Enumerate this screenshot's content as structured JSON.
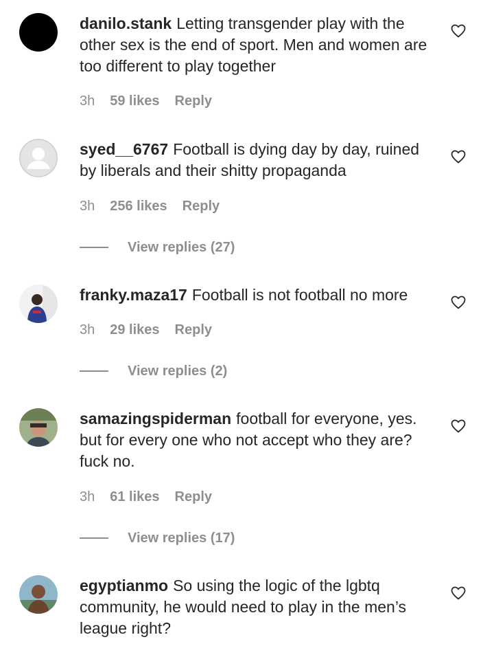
{
  "comments": [
    {
      "username": "danilo.stank",
      "text": "Letting transgender play with the other sex is the end of sport. Men and women are too different to play together",
      "time": "3h",
      "likes": "59 likes",
      "reply": "Reply",
      "avatar_color": "#000000"
    },
    {
      "username": "syed__6767",
      "text": "Football is dying day by day, ruined by liberals and their shitty propaganda",
      "time": "3h",
      "likes": "256 likes",
      "reply": "Reply",
      "view_replies": "View replies (27)",
      "avatar_color": "#dbdbdb"
    },
    {
      "username": "franky.maza17",
      "text": "Football is not football no more",
      "time": "3h",
      "likes": "29 likes",
      "reply": "Reply",
      "view_replies": "View replies (2)",
      "avatar_color": "#6b7fa0"
    },
    {
      "username": "samazingspiderman",
      "text": "football for everyone, yes. but for every one who not accept who they are? fuck no.",
      "time": "3h",
      "likes": "61 likes",
      "reply": "Reply",
      "view_replies": "View replies (17)",
      "avatar_color": "#7d8a6a"
    },
    {
      "username": "egyptianmo",
      "text": "So using the logic of the lgbtq community, he would need to play in the men’s league right?",
      "avatar_color": "#8a6a55"
    }
  ]
}
